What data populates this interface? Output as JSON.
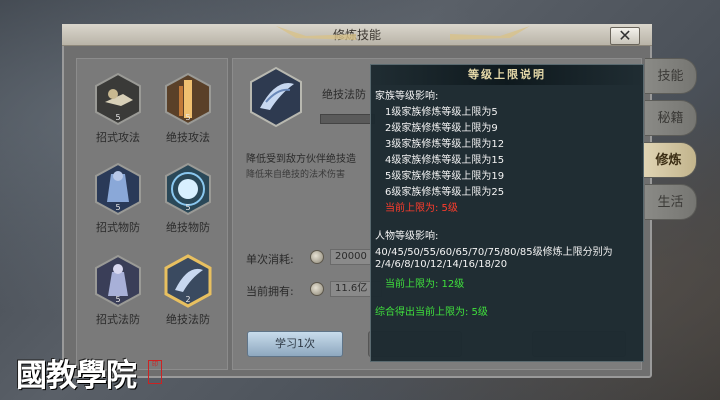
{
  "window": {
    "title": "修炼技能",
    "close_label": "✕"
  },
  "skills": [
    {
      "name": "招式攻法",
      "level": "5",
      "icon": "fist-strike-icon"
    },
    {
      "name": "绝技攻法",
      "level": "5",
      "icon": "flame-pillar-icon"
    },
    {
      "name": "招式物防",
      "level": "5",
      "icon": "armored-figure-icon"
    },
    {
      "name": "绝技物防",
      "level": "5",
      "icon": "light-burst-icon"
    },
    {
      "name": "招式法防",
      "level": "5",
      "icon": "robed-figure-icon"
    },
    {
      "name": "绝技法防",
      "level": "2",
      "icon": "blade-swirl-icon",
      "selected": true
    }
  ],
  "detail": {
    "skill_name": "绝技法防",
    "description": "降低受到敌方伙伴绝技造",
    "sub_description": "降低来自绝技的法术伤害",
    "cost_label": "单次消耗:",
    "cost_value": "20000",
    "own_label": "当前拥有:",
    "own_value": "11.6亿",
    "learn_button": "学习1次"
  },
  "tabs": [
    {
      "label": "技能"
    },
    {
      "label": "秘籍"
    },
    {
      "label": "修炼",
      "active": true
    },
    {
      "label": "生活"
    }
  ],
  "tooltip": {
    "title": "等级上限说明",
    "family_header": "家族等级影响:",
    "family_lines": [
      "1级家族修炼等级上限为5",
      "2级家族修炼等级上限为9",
      "3级家族修炼等级上限为12",
      "4级家族修炼等级上限为15",
      "5级家族修炼等级上限为19",
      "6级家族修炼等级上限为25"
    ],
    "family_current": "当前上限为: 5级",
    "char_header": "人物等级影响:",
    "char_line1": "40/45/50/55/60/65/70/75/80/85级修炼上限分别为",
    "char_line2": "2/4/6/8/10/12/14/16/18/20",
    "char_current": "当前上限为: 12级",
    "summary": "综合得出当前上限为: 5级"
  },
  "watermark": {
    "text": "國教學院",
    "seal": "印"
  },
  "colors": {
    "tooltip_bg": "#1c2a30",
    "limit_red": "#ff3c2c",
    "limit_green": "#3fe03c",
    "active_tab": "#d8c89c"
  }
}
